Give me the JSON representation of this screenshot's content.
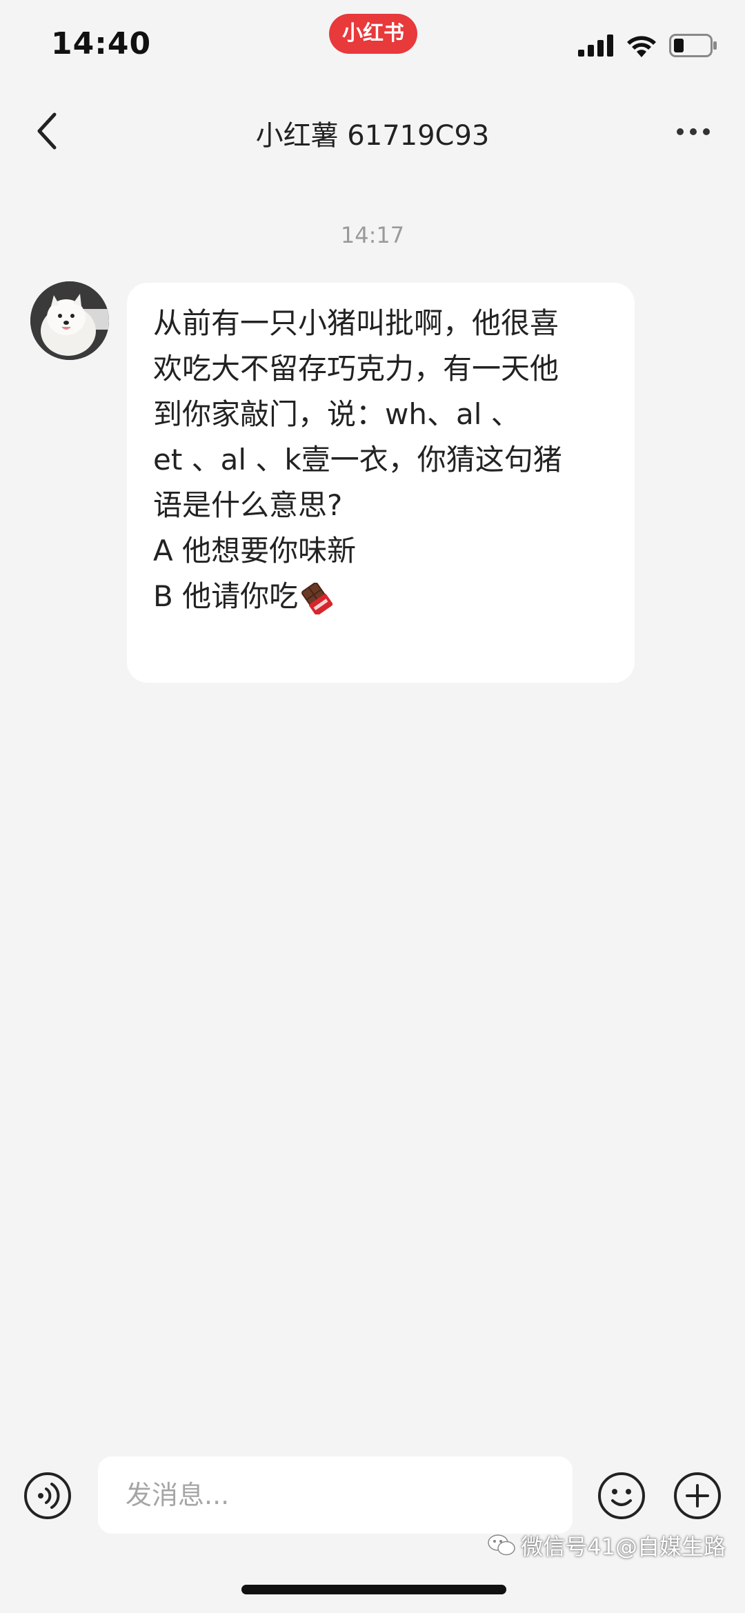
{
  "status_bar": {
    "time": "14:40",
    "app_badge": "小红书",
    "signal_icon": "signal-icon",
    "wifi_icon": "wifi-icon",
    "battery_icon": "battery-icon"
  },
  "header": {
    "title": "小红薯 61719C93",
    "back_icon": "chevron-left-icon",
    "more_icon": "more-dots-icon"
  },
  "chat": {
    "timestamp": "14:17",
    "message": {
      "avatar": "samoyed-dog-avatar",
      "lines": [
        "从前有一只小猪叫批啊，他很喜",
        "欢吃大不留存巧克力，有一天他",
        "到你家敲门，说：wh、al 、",
        "et 、al 、k壹一衣，你猜这句猪",
        "语是什么意思?",
        "A 他想要你味新",
        "B 他请你吃"
      ],
      "trailing_icon": "chocolate-bar-icon"
    }
  },
  "input_bar": {
    "placeholder": "发消息...",
    "voice_icon": "voice-icon",
    "emoji_icon": "smiley-icon",
    "plus_icon": "plus-circle-icon"
  },
  "watermark": {
    "text": "微信号41@自媒生路"
  },
  "colors": {
    "background": "#f4f4f5",
    "brand_red": "#e8393b",
    "bubble": "#ffffff",
    "timestamp_gray": "#9a9a9a"
  }
}
